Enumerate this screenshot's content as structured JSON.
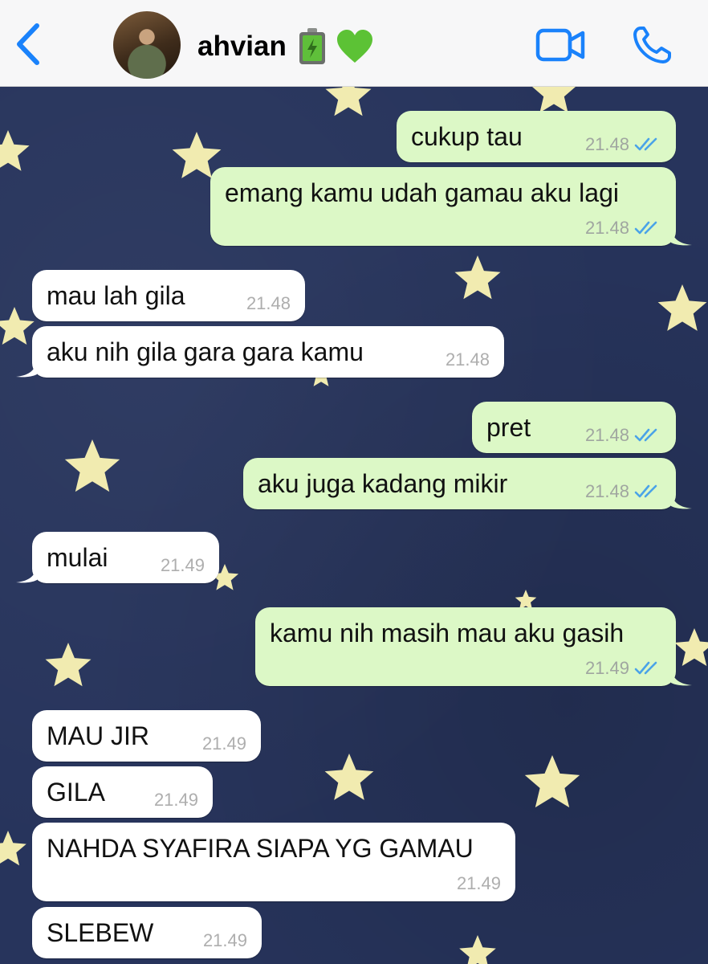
{
  "header": {
    "back_icon": "chevron-left-icon",
    "contact_name": "ahvian",
    "battery_emoji": "battery-icon",
    "heart_emoji": "green-heart-icon",
    "video_icon": "video-camera-icon",
    "phone_icon": "phone-icon",
    "accent_color": "#1a82fb"
  },
  "messages": [
    {
      "dir": "out",
      "text": "cukup tau",
      "time": "21.48",
      "read": true
    },
    {
      "dir": "out",
      "text": "emang kamu udah gamau aku lagi",
      "time": "21.48",
      "read": true
    },
    {
      "dir": "in",
      "text": "mau lah gila",
      "time": "21.48"
    },
    {
      "dir": "in",
      "text": "aku nih gila gara gara kamu",
      "time": "21.48"
    },
    {
      "dir": "out",
      "text": "pret",
      "time": "21.48",
      "read": true
    },
    {
      "dir": "out",
      "text": "aku juga kadang mikir",
      "time": "21.48",
      "read": true
    },
    {
      "dir": "in",
      "text": "mulai",
      "time": "21.49"
    },
    {
      "dir": "out",
      "text": "kamu nih masih mau aku gasih",
      "time": "21.49",
      "read": true
    },
    {
      "dir": "in",
      "text": "MAU JIR",
      "time": "21.49"
    },
    {
      "dir": "in",
      "text": "GILA",
      "time": "21.49"
    },
    {
      "dir": "in",
      "text": "NAHDA SYAFIRA SIAPA YG GAMAU",
      "time": "21.49"
    },
    {
      "dir": "in",
      "text": "SLEBEW",
      "time": "21.49"
    }
  ],
  "colors": {
    "outgoing_bubble": "#dcf8c6",
    "incoming_bubble": "#ffffff",
    "read_ticks": "#4aa3e8",
    "wallpaper": "#27345c",
    "star": "#f1ebb0"
  }
}
